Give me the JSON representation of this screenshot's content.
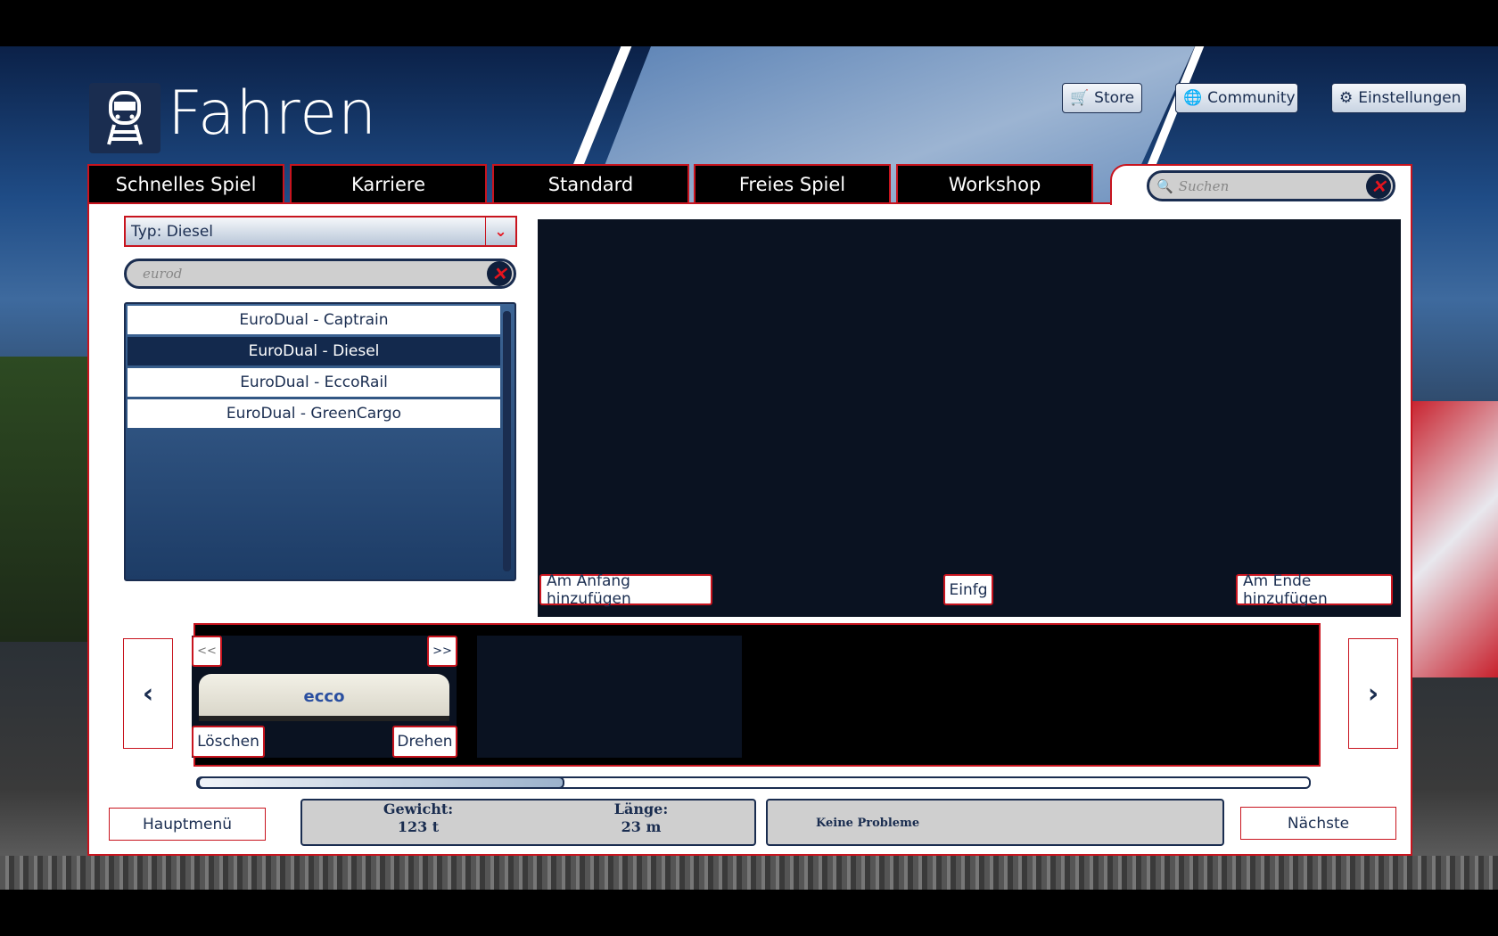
{
  "header": {
    "title": "Fahren",
    "icon": "train-icon"
  },
  "top_buttons": [
    {
      "label": "Store",
      "icon": "cart-icon"
    },
    {
      "label": "Community",
      "icon": "globe-icon"
    },
    {
      "label": "Einstellungen",
      "icon": "gear-icon"
    }
  ],
  "tabs": [
    {
      "label": "Schnelles Spiel"
    },
    {
      "label": "Karriere"
    },
    {
      "label": "Standard"
    },
    {
      "label": "Freies Spiel"
    },
    {
      "label": "Workshop"
    }
  ],
  "search": {
    "placeholder": "Suchen"
  },
  "filter": {
    "type_label": "Typ: Diesel",
    "query": "eurod"
  },
  "list": {
    "items": [
      "EuroDual - Captrain",
      "EuroDual - Diesel",
      "EuroDual - EccoRail",
      "EuroDual - GreenCargo"
    ],
    "selected": 1
  },
  "preview": {
    "add_start": "Am Anfang hinzufügen",
    "insert": "Einfg",
    "add_end": "Am Ende hinzufügen"
  },
  "consist": {
    "prev": "<<",
    "next": ">>",
    "delete": "Löschen",
    "rotate": "Drehen",
    "train_logo": "ecco",
    "scroll_fraction": 0.33
  },
  "stats": {
    "weight_label": "Gewicht:",
    "weight_value": "123 t",
    "length_label": "Länge:",
    "length_value": "23 m",
    "status": "Keine Probleme"
  },
  "footer": {
    "main_menu": "Hauptmenü",
    "next": "Nächste"
  },
  "colors": {
    "accent": "#c8141e",
    "navy": "#1a2d50"
  }
}
